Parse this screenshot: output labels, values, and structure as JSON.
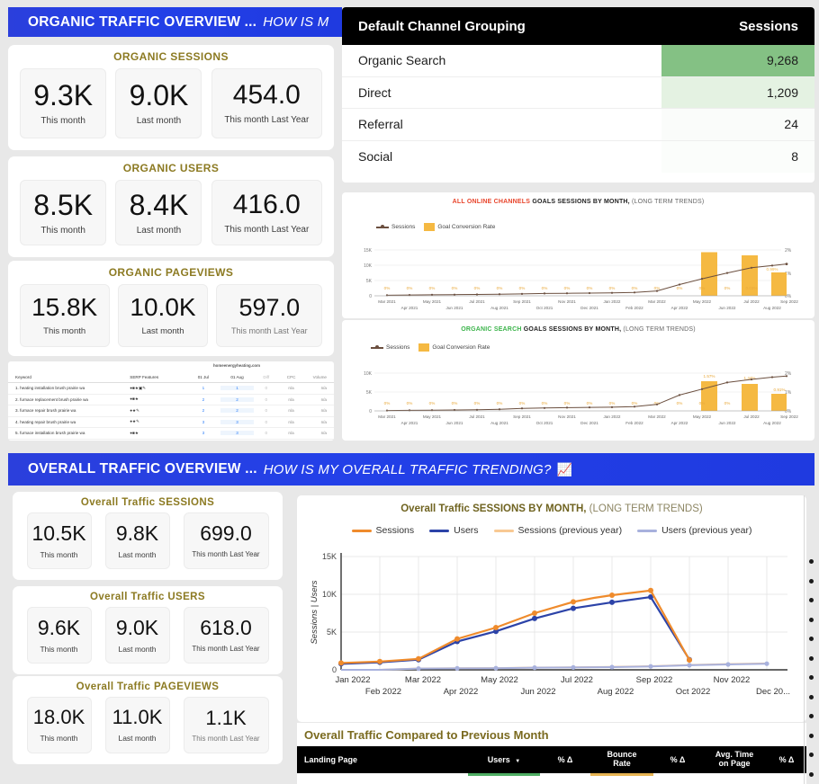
{
  "organic_banner": {
    "title_strong": "ORGANIC TRAFFIC OVERVIEW ...",
    "title_italic": "HOW IS M"
  },
  "overall_banner": {
    "title_strong": "OVERALL TRAFFIC OVERVIEW ...",
    "title_italic": "HOW IS MY OVERALL TRAFFIC TRENDING?",
    "icon": "chart-increasing-icon"
  },
  "organic_kpis": [
    {
      "title": "ORGANIC SESSIONS",
      "boxes": [
        {
          "value": "9.3K",
          "label": "This month"
        },
        {
          "value": "9.0K",
          "label": "Last month"
        },
        {
          "value": "454.0",
          "label": "This month Last Year"
        }
      ]
    },
    {
      "title": "ORGANIC USERS",
      "boxes": [
        {
          "value": "8.5K",
          "label": "This month"
        },
        {
          "value": "8.4K",
          "label": "Last month"
        },
        {
          "value": "416.0",
          "label": "This month Last Year"
        }
      ]
    },
    {
      "title": "ORGANIC PAGEVIEWS",
      "boxes": [
        {
          "value": "15.8K",
          "label": "This month"
        },
        {
          "value": "10.0K",
          "label": "Last month"
        },
        {
          "value": "597.0",
          "label": "This month Last Year"
        }
      ]
    }
  ],
  "overall_kpis": [
    {
      "title": "Overall Traffic SESSIONS",
      "boxes": [
        {
          "value": "10.5K",
          "label": "This month"
        },
        {
          "value": "9.8K",
          "label": "Last month"
        },
        {
          "value": "699.0",
          "label": "This month Last Year"
        }
      ]
    },
    {
      "title": "Overall Traffic  USERS",
      "boxes": [
        {
          "value": "9.6K",
          "label": "This month"
        },
        {
          "value": "9.0K",
          "label": "Last month"
        },
        {
          "value": "618.0",
          "label": "This month Last Year"
        }
      ]
    },
    {
      "title": "Overall Traffic  PAGEVIEWS",
      "boxes": [
        {
          "value": "18.0K",
          "label": "This month"
        },
        {
          "value": "11.0K",
          "label": "Last month"
        },
        {
          "value": "1.1K",
          "label": "This month Last Year"
        }
      ]
    }
  ],
  "channel_table": {
    "columns": [
      "Default Channel Grouping",
      "Sessions"
    ],
    "rows": [
      {
        "channel": "Organic Search",
        "sessions": "9,268",
        "bar_color": "#84c184"
      },
      {
        "channel": "Direct",
        "sessions": "1,209",
        "bar_color": "#e4f2e2"
      },
      {
        "channel": "Referral",
        "sessions": "24",
        "bar_color": "#fafcfa"
      },
      {
        "channel": "Social",
        "sessions": "8",
        "bar_color": "#fbfdfb"
      }
    ]
  },
  "keyword_table": {
    "group_header": "homeenergyheating.com",
    "columns": [
      "Keyword",
      "SERP Features",
      "01 Jul",
      "01 Aug",
      "Diff",
      "CPC",
      "Volume"
    ],
    "rows": [
      {
        "keyword": "1. heating installation brush prairie wa",
        "jul": "1",
        "aug": "1",
        "diff": "0",
        "cpc": "n/a",
        "volume": "n/a"
      },
      {
        "keyword": "2. furnace replacement brush prairie wa",
        "jul": "2",
        "aug": "2",
        "diff": "0",
        "cpc": "n/a",
        "volume": "n/a"
      },
      {
        "keyword": "3. furnace repair brush prairie wa",
        "jul": "2",
        "aug": "2",
        "diff": "0",
        "cpc": "n/a",
        "volume": "n/a"
      },
      {
        "keyword": "4. heating repair brush prairie wa",
        "jul": "3",
        "aug": "3",
        "diff": "0",
        "cpc": "n/a",
        "volume": "n/a"
      },
      {
        "keyword": "5. furnace installation brush prairie wa",
        "jul": "3",
        "aug": "3",
        "diff": "0",
        "cpc": "n/a",
        "volume": "n/a"
      }
    ]
  },
  "bottom_table": {
    "title": "Overall Traffic Compared to Previous Month",
    "columns": [
      "Landing Page",
      "Users",
      "% Δ",
      "Bounce Rate",
      "% Δ",
      "Avg. Time on Page",
      "% Δ"
    ],
    "sort_indicator": "▼"
  },
  "chart_data": [
    {
      "type": "line",
      "id": "all-online-channels-goals",
      "title_accent": "ALL ONLINE CHANNELS",
      "title_accent_color": "#e8452c",
      "title_main": "GOALS SESSIONS BY MONTH,",
      "title_sub": "(LONG TERM TRENDS)",
      "legend": [
        "Sessions",
        "Goal Conversion Rate"
      ],
      "legend_position": "top-left",
      "grid": true,
      "x": [
        "Mar 2021",
        "Apr 2021",
        "May 2021",
        "Jun 2021",
        "Jul 2021",
        "Aug 2021",
        "Sep 2021",
        "Oct 2021",
        "Nov 2021",
        "Dec 2021",
        "Jan 2022",
        "Feb 2022",
        "Mar 2022",
        "Apr 2022",
        "May 2022",
        "Jun 2022",
        "Jul 2022",
        "Aug 2022",
        "Sep 2022"
      ],
      "ylabel": "",
      "ylim": [
        0,
        15000
      ],
      "yticks": [
        "0",
        "5K",
        "10K",
        "15K"
      ],
      "y2lim": [
        0,
        2
      ],
      "y2ticks": [
        "0%",
        "1%",
        "2%"
      ],
      "series": [
        {
          "name": "Sessions",
          "type": "line",
          "color": "#6b4f3f",
          "values": [
            180,
            260,
            320,
            380,
            430,
            520,
            620,
            760,
            820,
            900,
            980,
            1100,
            1600,
            3700,
            5600,
            7500,
            9200,
            9900,
            10400
          ]
        },
        {
          "name": "Goal Conversion Rate",
          "type": "bar",
          "color": "#f5b942",
          "values": [
            0,
            0,
            0,
            0,
            0,
            0,
            0,
            0,
            0,
            0,
            0,
            0,
            0,
            0,
            0,
            0.03,
            1.93,
            1.78,
            1.04
          ],
          "labels": [
            "0%",
            "0%",
            "0%",
            "0%",
            "0%",
            "0%",
            "0%",
            "0%",
            "0%",
            "0%",
            "0%",
            "0%",
            "0%",
            "0%",
            "0%",
            "0.03%",
            "",
            "",
            "0.99%"
          ]
        }
      ]
    },
    {
      "type": "line",
      "id": "organic-search-goals",
      "title_accent": "ORGANIC SEARCH",
      "title_accent_color": "#3cb44b",
      "title_main": "GOALS SESSIONS BY MONTH,",
      "title_sub": "(LONG TERM TRENDS)",
      "legend": [
        "Sessions",
        "Goal Conversion Rate"
      ],
      "legend_position": "top-left",
      "grid": true,
      "x": [
        "Mar 2021",
        "Apr 2021",
        "May 2021",
        "Jun 2021",
        "Jul 2021",
        "Aug 2021",
        "Sep 2021",
        "Oct 2021",
        "Nov 2021",
        "Dec 2021",
        "Jan 2022",
        "Feb 2022",
        "Mar 2022",
        "Apr 2022",
        "May 2022",
        "Jun 2022",
        "Jul 2022",
        "Aug 2022",
        "Sep 2022"
      ],
      "ylabel": "",
      "ylim": [
        0,
        10000
      ],
      "yticks": [
        "0",
        "5K",
        "10K"
      ],
      "y2lim": [
        0,
        2
      ],
      "y2ticks": [
        "0%",
        "1%",
        "2%"
      ],
      "series": [
        {
          "name": "Sessions",
          "type": "line",
          "color": "#6b4f3f",
          "values": [
            60,
            90,
            120,
            160,
            200,
            330,
            480,
            560,
            620,
            680,
            720,
            800,
            1200,
            3600,
            4900,
            6700,
            8100,
            9200,
            9500
          ]
        },
        {
          "name": "Goal Conversion Rate",
          "type": "bar",
          "color": "#f5b942",
          "values": [
            0,
            0,
            0,
            0,
            0,
            0,
            0,
            0,
            0,
            0,
            0,
            0,
            0,
            0,
            0,
            0,
            1.57,
            1.44,
            0.91
          ],
          "labels": [
            "0%",
            "0%",
            "0%",
            "0%",
            "0%",
            "0%",
            "0%",
            "0%",
            "0%",
            "0%",
            "0%",
            "0%",
            "0%",
            "0%",
            "0%",
            "0%",
            "1.57%",
            "1.44%",
            "0.91%"
          ]
        }
      ]
    },
    {
      "type": "line",
      "id": "overall-traffic-sessions-by-month",
      "title_main": "Overall Traffic SESSIONS BY MONTH,",
      "title_sub": "(LONG TERM TRENDS)",
      "legend": [
        "Sessions",
        "Users",
        "Sessions (previous year)",
        "Users (previous year)"
      ],
      "legend_position": "top-center",
      "grid": true,
      "xlabel": "",
      "x": [
        "Jan 2022",
        "Feb 2022",
        "Mar 2022",
        "Apr 2022",
        "May 2022",
        "Jun 2022",
        "Jul 2022",
        "Aug 2022",
        "Sep 2022",
        "Oct 2022",
        "Nov 2022",
        "Dec 20..."
      ],
      "ylabel": "Sessions | Users",
      "ylim": [
        0,
        15000
      ],
      "yticks": [
        "0",
        "5K",
        "10K",
        "15K"
      ],
      "series": [
        {
          "name": "Sessions",
          "color": "#ef8b2c",
          "values": [
            900,
            1100,
            1450,
            4100,
            5600,
            7500,
            9000,
            9850,
            10500,
            1300,
            null,
            null
          ]
        },
        {
          "name": "Users",
          "color": "#2c43a8",
          "values": [
            800,
            1000,
            1350,
            3750,
            5100,
            6800,
            8150,
            8950,
            9650,
            1350,
            null,
            null
          ]
        },
        {
          "name": "Sessions (previous year)",
          "color": "#f8c993",
          "values": [
            0,
            0,
            180,
            200,
            230,
            300,
            330,
            380,
            480,
            640,
            760,
            850
          ]
        },
        {
          "name": "Users (previous year)",
          "color": "#a8b1dd",
          "values": [
            0,
            0,
            170,
            190,
            215,
            280,
            310,
            355,
            450,
            600,
            720,
            810
          ]
        }
      ]
    }
  ]
}
